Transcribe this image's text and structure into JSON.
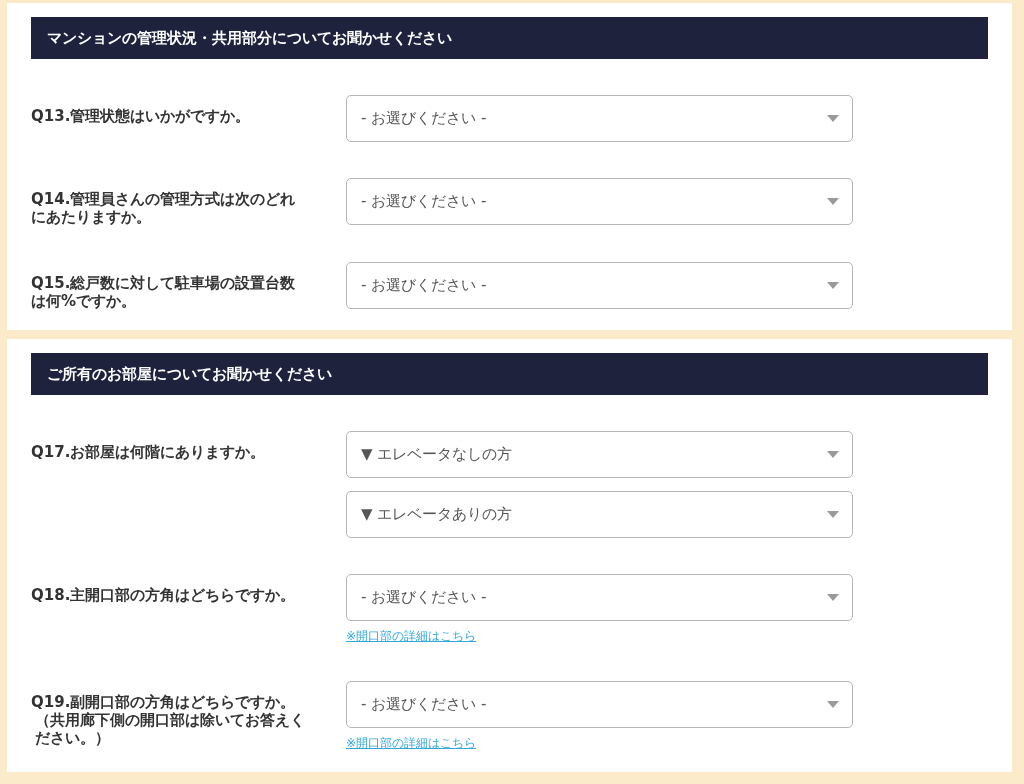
{
  "sections": [
    {
      "title": "マンションの管理状況・共用部分についてお聞かせください",
      "questions": [
        {
          "label": "Q13.管理状態はいかがですか。",
          "selects": [
            {
              "value": "- お選びください -"
            }
          ]
        },
        {
          "label": "Q14.管理員さんの管理方式は次のどれにあたりますか。",
          "selects": [
            {
              "value": "- お選びください -"
            }
          ]
        },
        {
          "label": "Q15.総戸数に対して駐車場の設置台数は何%ですか。",
          "selects": [
            {
              "value": "- お選びください -"
            }
          ]
        }
      ]
    },
    {
      "title": "ご所有のお部屋についてお聞かせください",
      "questions": [
        {
          "label": "Q17.お部屋は何階にありますか。",
          "selects": [
            {
              "value": "▼ エレベータなしの方"
            },
            {
              "value": "▼ エレベータありの方"
            }
          ]
        },
        {
          "label": "Q18.主開口部の方角はどちらですか。",
          "selects": [
            {
              "value": "- お選びください -"
            }
          ],
          "link": "※開口部の詳細はこちら"
        },
        {
          "label": "Q19.副開口部の方角はどちらですか。",
          "note": "（共用廊下側の開口部は除いてお答えください。）",
          "selects": [
            {
              "value": "- お選びください -"
            }
          ],
          "link": "※開口部の詳細はこちら"
        }
      ]
    }
  ]
}
